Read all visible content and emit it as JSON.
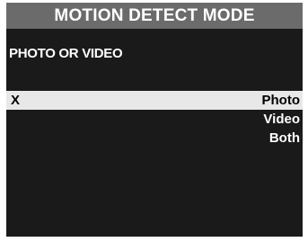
{
  "header": {
    "title": "MOTION DETECT MODE"
  },
  "setting": {
    "label": "PHOTO OR VIDEO"
  },
  "options": {
    "selection_marker": "X",
    "items": [
      {
        "label": "Photo",
        "selected": true
      },
      {
        "label": "Video",
        "selected": false
      },
      {
        "label": "Both",
        "selected": false
      }
    ]
  },
  "colors": {
    "title_bar": "#6b6b6b",
    "screen_background": "#1a1a1a",
    "selected_row": "#e8e8e8",
    "text": "#ffffff",
    "selected_text": "#000000"
  }
}
